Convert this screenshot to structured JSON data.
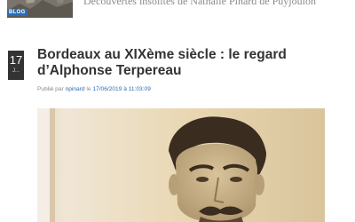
{
  "header": {
    "category_badge": "BLOG",
    "tagline": "Découvertes insolites de Nathalie Pinard de Puyjoulon"
  },
  "post": {
    "date": {
      "day": "17",
      "month": "J..."
    },
    "title": "Bordeaux au XIXème siècle : le regard d’Alphonse Terpereau",
    "meta": {
      "prefix": "Publié par",
      "author": "npinard",
      "connector": "le",
      "datetime": "17/06/2019 à 11:03:09"
    }
  },
  "featured_image": {
    "subject": "sepia portrait photograph"
  },
  "colors": {
    "accent": "#2a6db5",
    "date_block": "#333333",
    "title": "#333333",
    "meta": "#8a8a8a"
  }
}
